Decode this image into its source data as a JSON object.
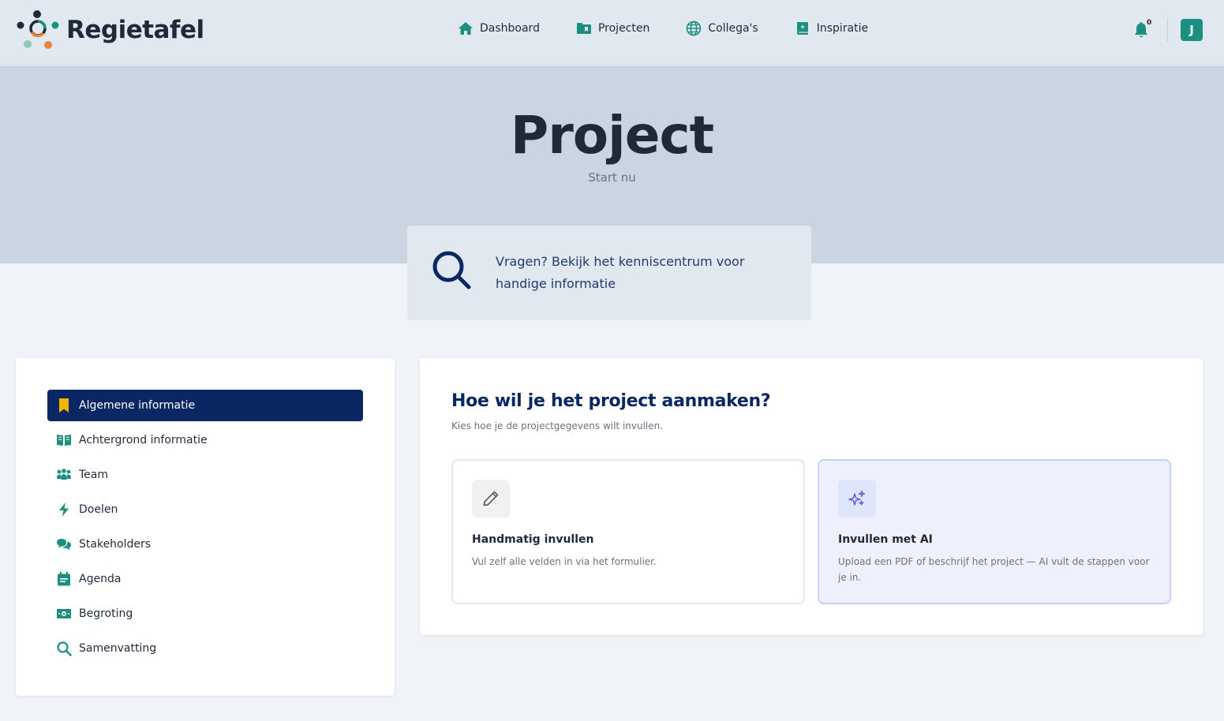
{
  "app": {
    "name": "Regietafel"
  },
  "nav": {
    "items": [
      {
        "label": "Dashboard",
        "icon": "home-icon"
      },
      {
        "label": "Projecten",
        "icon": "folder-icon"
      },
      {
        "label": "Collega's",
        "icon": "globe-icon"
      },
      {
        "label": "Inspiratie",
        "icon": "book-icon"
      }
    ]
  },
  "notifications": {
    "count": "0"
  },
  "user": {
    "initial": "J"
  },
  "hero": {
    "title": "Project",
    "subtitle": "Start nu"
  },
  "help": {
    "text": "Vragen? Bekijk het kenniscentrum voor handige informatie"
  },
  "sidebar": {
    "items": [
      {
        "label": "Algemene informatie",
        "icon": "bookmark-icon",
        "active": true
      },
      {
        "label": "Achtergrond informatie",
        "icon": "open-book-icon"
      },
      {
        "label": "Team",
        "icon": "users-icon"
      },
      {
        "label": "Doelen",
        "icon": "lightning-icon"
      },
      {
        "label": "Stakeholders",
        "icon": "chat-icon"
      },
      {
        "label": "Agenda",
        "icon": "calendar-icon"
      },
      {
        "label": "Begroting",
        "icon": "money-icon"
      },
      {
        "label": "Samenvatting",
        "icon": "search-icon"
      }
    ]
  },
  "main": {
    "title": "Hoe wil je het project aanmaken?",
    "subtitle": "Kies hoe je de projectgegevens wilt invullen.",
    "options": [
      {
        "title": "Handmatig invullen",
        "desc": "Vul zelf alle velden in via het formulier.",
        "icon": "pencil-icon"
      },
      {
        "title": "Invullen met AI",
        "desc": "Upload een PDF of beschrijf het project — AI vult de stappen voor je in.",
        "icon": "sparkles-icon"
      }
    ]
  },
  "colors": {
    "accent_teal": "#1b8f80",
    "navy": "#0b2763",
    "active_marker": "#f5b301",
    "ai_purple": "#5b5bd6"
  }
}
